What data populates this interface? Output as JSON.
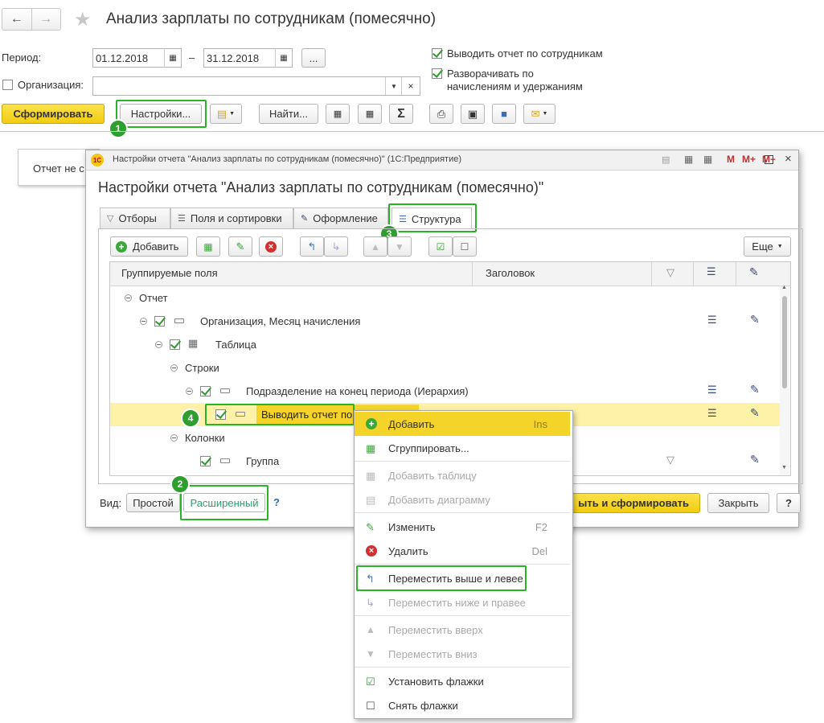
{
  "main": {
    "title": "Анализ зарплаты по сотрудникам (помесячно)",
    "period_label": "Период:",
    "date_from": "01.12.2018",
    "date_dash": "–",
    "date_to": "31.12.2018",
    "more_label": "...",
    "org_label": "Организация:",
    "org_value": "",
    "opt_by_employee": "Выводить отчет по сотрудникам",
    "opt_expand_line1": "Разворачивать по",
    "opt_expand_line2": "начислениям и удержаниям",
    "generate_button": "Сформировать",
    "settings_button": "Настройки...",
    "find_button": "Найти...",
    "report_stub": "Отчет не с"
  },
  "dialog": {
    "window_title": "Настройки отчета \"Анализ зарплаты по сотрудникам (помесячно)\"  (1С:Предприятие)",
    "heading": "Настройки отчета \"Анализ зарплаты по сотрудникам (помесячно)\"",
    "title_buttons": [
      "M",
      "M+",
      "M−"
    ],
    "tabs": [
      "Отборы",
      "Поля и сортировки",
      "Оформление",
      "Структура"
    ],
    "add_button": "Добавить",
    "more_button": "Еще",
    "col_fields": "Группируемые поля",
    "col_title": "Заголовок",
    "tree": [
      {
        "label": "Отчет"
      },
      {
        "label": "Организация, Месяц начисления"
      },
      {
        "label": "Таблица"
      },
      {
        "label": "Строки"
      },
      {
        "label": "Подразделение на конец периода (Иерархия)"
      },
      {
        "label": "Выводить отчет по"
      },
      {
        "label": "Колонки"
      },
      {
        "label": "Группа"
      }
    ],
    "view_label": "Вид:",
    "view_simple": "Простой",
    "view_extended": "Расширенный",
    "help_q": "?",
    "close_generate": "ыть и сформировать",
    "close": "Закрыть",
    "help_button": "?"
  },
  "context_menu": [
    {
      "label": "Добавить",
      "shortcut": "Ins",
      "enabled": true
    },
    {
      "label": "Сгруппировать...",
      "shortcut": "",
      "enabled": true
    },
    {
      "label": "Добавить таблицу",
      "shortcut": "",
      "enabled": false
    },
    {
      "label": "Добавить диаграмму",
      "shortcut": "",
      "enabled": false
    },
    {
      "label": "Изменить",
      "shortcut": "F2",
      "enabled": true
    },
    {
      "label": "Удалить",
      "shortcut": "Del",
      "enabled": true
    },
    {
      "label": "Переместить выше и левее",
      "shortcut": "",
      "enabled": true
    },
    {
      "label": "Переместить ниже и правее",
      "shortcut": "",
      "enabled": false
    },
    {
      "label": "Переместить вверх",
      "shortcut": "",
      "enabled": false
    },
    {
      "label": "Переместить вниз",
      "shortcut": "",
      "enabled": false
    },
    {
      "label": "Установить флажки",
      "shortcut": "",
      "enabled": true
    },
    {
      "label": "Снять флажки",
      "shortcut": "",
      "enabled": true
    }
  ],
  "markers": [
    "1",
    "2",
    "3",
    "4"
  ],
  "colors": {
    "accent_yellow": "#f5d42a",
    "highlight_green": "#27b527",
    "row_selected": "#fdf2a8"
  }
}
